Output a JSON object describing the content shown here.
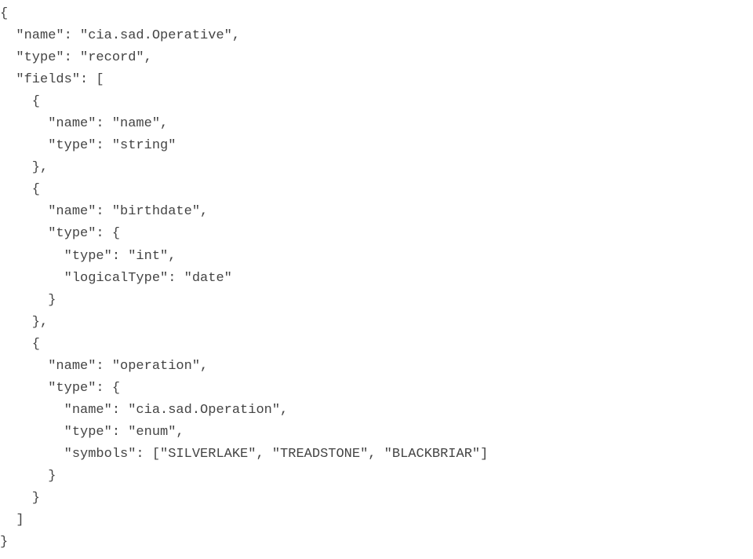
{
  "code": "{\n  \"name\": \"cia.sad.Operative\",\n  \"type\": \"record\",\n  \"fields\": [\n    {\n      \"name\": \"name\",\n      \"type\": \"string\"\n    },\n    {\n      \"name\": \"birthdate\",\n      \"type\": {\n        \"type\": \"int\",\n        \"logicalType\": \"date\"\n      }\n    },\n    {\n      \"name\": \"operation\",\n      \"type\": {\n        \"name\": \"cia.sad.Operation\",\n        \"type\": \"enum\",\n        \"symbols\": [\"SILVERLAKE\", \"TREADSTONE\", \"BLACKBRIAR\"]\n      }\n    }\n  ]\n}"
}
